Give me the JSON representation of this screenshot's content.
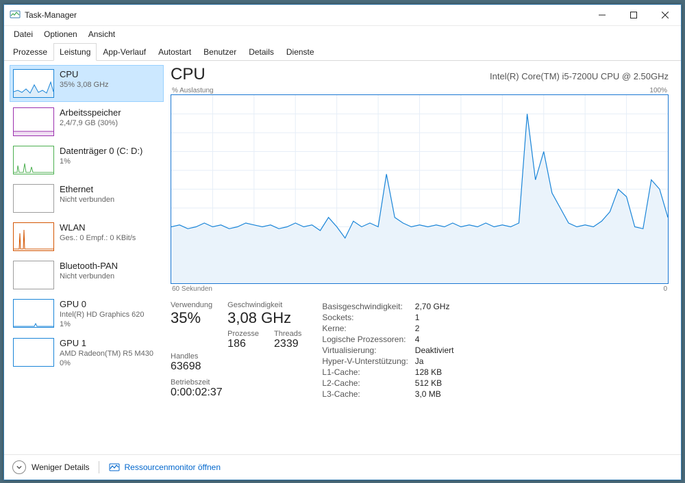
{
  "window": {
    "title": "Task-Manager"
  },
  "menu": [
    "Datei",
    "Optionen",
    "Ansicht"
  ],
  "tabs": [
    "Prozesse",
    "Leistung",
    "App-Verlauf",
    "Autostart",
    "Benutzer",
    "Details",
    "Dienste"
  ],
  "active_tab": 1,
  "sidebar": [
    {
      "title": "CPU",
      "sub": "35%  3,08 GHz",
      "selected": true,
      "color": "#1a85d8",
      "miniType": "cpu"
    },
    {
      "title": "Arbeitsspeicher",
      "sub": "2,4/7,9 GB (30%)",
      "color": "#9b2fae",
      "miniType": "flat"
    },
    {
      "title": "Datenträger 0 (C: D:)",
      "sub": "1%",
      "color": "#4caf50",
      "miniType": "spikes"
    },
    {
      "title": "Ethernet",
      "sub": "Nicht verbunden",
      "color": "#9e9e9e",
      "miniType": "none"
    },
    {
      "title": "WLAN",
      "sub": "Ges.: 0  Empf.: 0 KBit/s",
      "color": "#d35400",
      "miniType": "twospike"
    },
    {
      "title": "Bluetooth-PAN",
      "sub": "Nicht verbunden",
      "color": "#9e9e9e",
      "miniType": "none"
    },
    {
      "title": "GPU 0",
      "sub": "Intel(R) HD Graphics 620",
      "sub2": "1%",
      "color": "#1a85d8",
      "miniType": "tiny"
    },
    {
      "title": "GPU 1",
      "sub": "AMD Radeon(TM) R5 M430",
      "sub2": "0%",
      "color": "#1a85d8",
      "miniType": "none"
    }
  ],
  "main": {
    "title": "CPU",
    "subtitle": "Intel(R) Core(TM) i5-7200U CPU @ 2.50GHz",
    "chart_top_left": "% Auslastung",
    "chart_top_right": "100%",
    "chart_bottom_left": "60 Sekunden",
    "chart_bottom_right": "0"
  },
  "stats": {
    "usage_label": "Verwendung",
    "usage_value": "35%",
    "speed_label": "Geschwindigkeit",
    "speed_value": "3,08 GHz",
    "proc_label": "Prozesse",
    "proc_value": "186",
    "threads_label": "Threads",
    "threads_value": "2339",
    "handles_label": "Handles",
    "handles_value": "63698",
    "uptime_label": "Betriebszeit",
    "uptime_value": "0:00:02:37"
  },
  "info": [
    {
      "k": "Basisgeschwindigkeit:",
      "v": "2,70 GHz"
    },
    {
      "k": "Sockets:",
      "v": "1"
    },
    {
      "k": "Kerne:",
      "v": "2"
    },
    {
      "k": "Logische Prozessoren:",
      "v": "4"
    },
    {
      "k": "Virtualisierung:",
      "v": "Deaktiviert"
    },
    {
      "k": "Hyper-V-Unterstützung:",
      "v": "Ja"
    },
    {
      "k": "L1-Cache:",
      "v": "128 KB"
    },
    {
      "k": "L2-Cache:",
      "v": "512 KB"
    },
    {
      "k": "L3-Cache:",
      "v": "3,0 MB"
    }
  ],
  "footer": {
    "fewer_details": "Weniger Details",
    "resmon": "Ressourcenmonitor öffnen"
  },
  "chart_data": {
    "type": "area",
    "title": "CPU % Auslastung",
    "xlabel": "60 Sekunden",
    "ylabel": "% Auslastung",
    "ylim": [
      0,
      100
    ],
    "x": [
      0,
      1,
      2,
      3,
      4,
      5,
      6,
      7,
      8,
      9,
      10,
      11,
      12,
      13,
      14,
      15,
      16,
      17,
      18,
      19,
      20,
      21,
      22,
      23,
      24,
      25,
      26,
      27,
      28,
      29,
      30,
      31,
      32,
      33,
      34,
      35,
      36,
      37,
      38,
      39,
      40,
      41,
      42,
      43,
      44,
      45,
      46,
      47,
      48,
      49,
      50,
      51,
      52,
      53,
      54,
      55,
      56,
      57,
      58,
      59,
      60
    ],
    "values": [
      30,
      31,
      29,
      30,
      32,
      30,
      31,
      29,
      30,
      32,
      31,
      30,
      31,
      29,
      30,
      32,
      30,
      31,
      28,
      35,
      30,
      24,
      33,
      30,
      32,
      30,
      58,
      35,
      32,
      30,
      31,
      30,
      31,
      30,
      32,
      30,
      31,
      30,
      32,
      30,
      31,
      30,
      32,
      90,
      55,
      70,
      48,
      40,
      32,
      30,
      31,
      30,
      33,
      38,
      50,
      46,
      30,
      29,
      55,
      50,
      35
    ]
  }
}
